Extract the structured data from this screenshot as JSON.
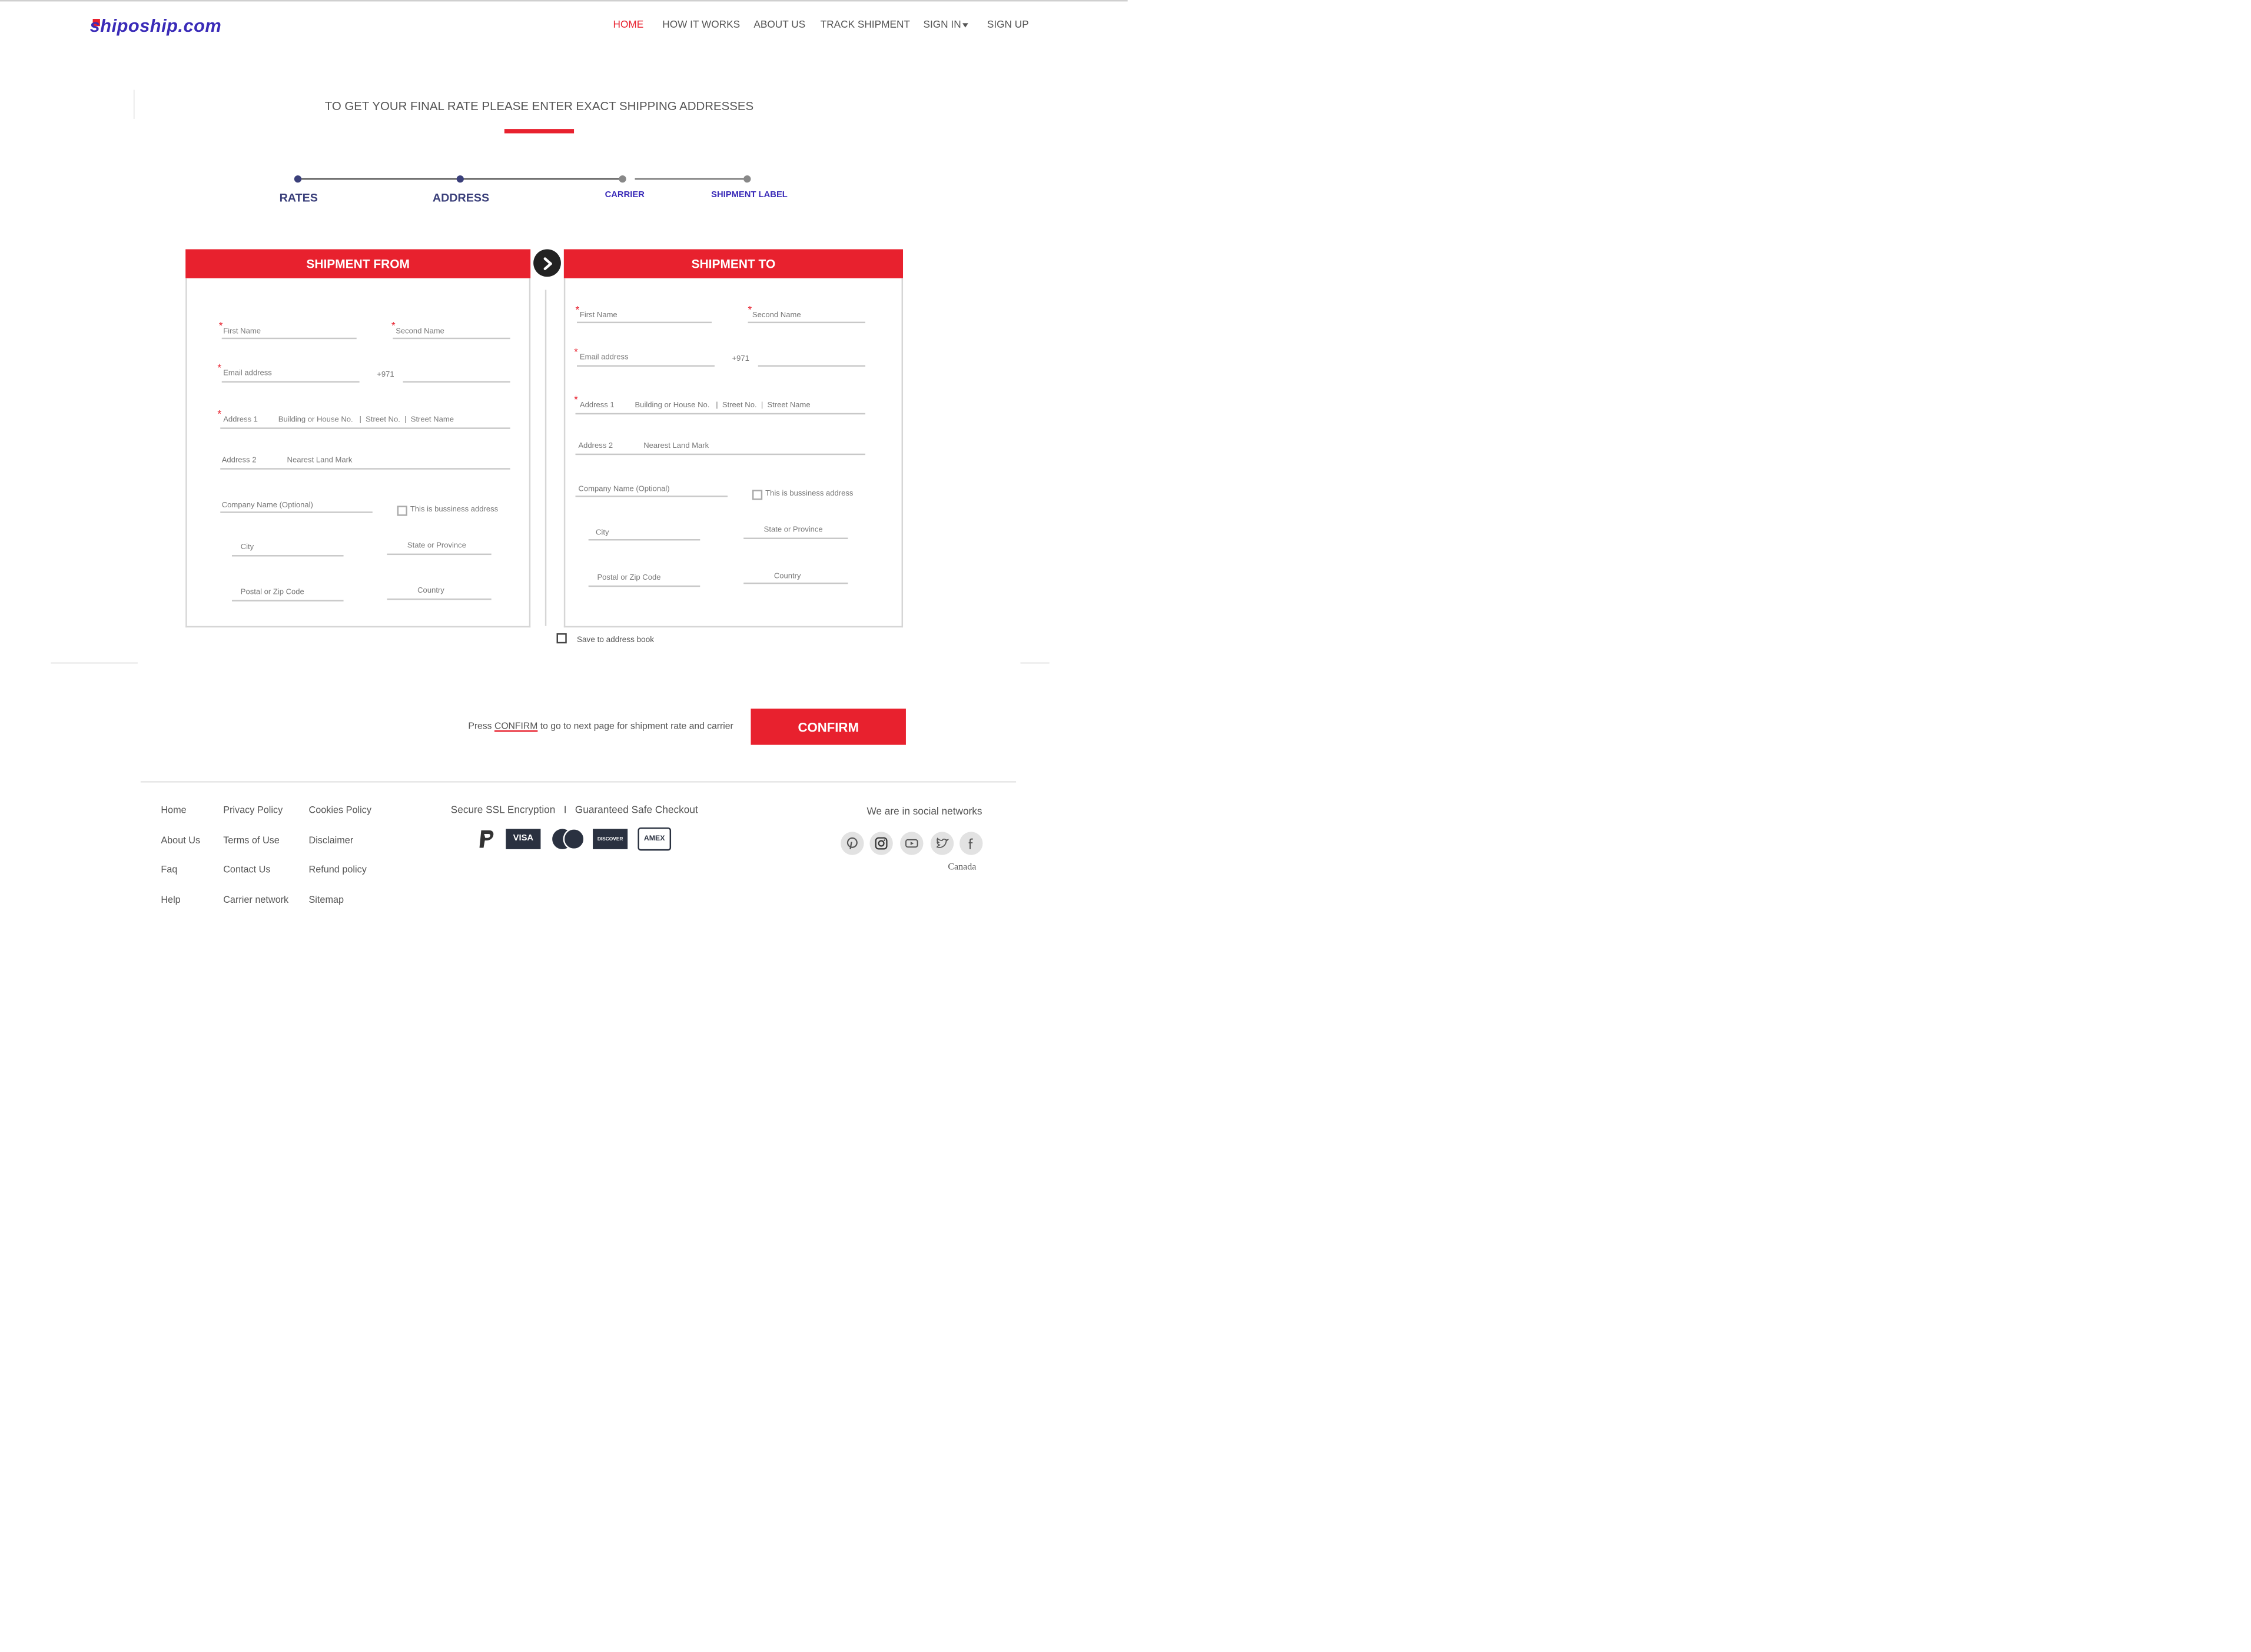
{
  "brand": {
    "name": "shipoship.com",
    "accent": "#e8212e",
    "logo_color": "#3a2bb8"
  },
  "nav": {
    "items": [
      {
        "label": "HOME",
        "active": true
      },
      {
        "label": "HOW IT WORKS",
        "active": false
      },
      {
        "label": "ABOUT US",
        "active": false
      },
      {
        "label": "TRACK SHIPMENT",
        "active": false
      },
      {
        "label": "SIGN IN",
        "active": false,
        "dropdown": true
      },
      {
        "label": "SIGN UP",
        "active": false
      }
    ]
  },
  "main": {
    "heading": "TO GET YOUR FINAL RATE PLEASE ENTER EXACT SHIPPING ADDRESSES",
    "steps": [
      {
        "label": "RATES",
        "state": "done"
      },
      {
        "label": "ADDRESS",
        "state": "current"
      },
      {
        "label": "CARRIER",
        "state": "todo"
      },
      {
        "label": "SHIPMENT LABEL",
        "state": "todo"
      }
    ],
    "step_colors": {
      "done": "#3a3f7a",
      "todo": "#3a2bb8"
    },
    "from": {
      "title": "SHIPMENT FROM",
      "first_name": "First Name",
      "second_name": "Second Name",
      "email": "Email address",
      "phone_prefix": "+971",
      "address1_label": "Address 1",
      "address1_hint": "Building or House No.   |  Street No.  |  Street Name",
      "address2_label": "Address 2",
      "address2_hint": "Nearest Land Mark",
      "company": "Company Name (Optional)",
      "business_checkbox": "This is bussiness address",
      "city": "City",
      "state": "State or Province",
      "postal": "Postal or Zip Code",
      "country": "Country"
    },
    "to": {
      "title": "SHIPMENT TO",
      "first_name": "First Name",
      "second_name": "Second Name",
      "email": "Email address",
      "phone_prefix": "+971",
      "address1_label": "Address 1",
      "address1_hint": "Building or House No.   |  Street No.  |  Street Name",
      "address2_label": "Address 2",
      "address2_hint": "Nearest Land Mark",
      "company": "Company Name (Optional)",
      "business_checkbox": "This is bussiness address",
      "city": "City",
      "state": "State or Province",
      "postal": "Postal or Zip Code",
      "country": "Country"
    },
    "save_address_book": "Save to address book",
    "confirm_prefix": "Press ",
    "confirm_word": "CONFIRM",
    "confirm_suffix": " to go to next page for shipment rate and carrier",
    "confirm_button": "CONFIRM"
  },
  "footer": {
    "col1": [
      "Home",
      "About Us",
      "Faq",
      "Help"
    ],
    "col2": [
      "Privacy Policy",
      "Terms of Use",
      "Contact Us",
      "Carrier network"
    ],
    "col3": [
      "Cookies Policy",
      "Disclaimer",
      "Refund policy",
      "Sitemap"
    ],
    "secure_text": "Secure SSL Encryption   I   Guaranteed Safe Checkout",
    "payment_methods": [
      "paypal-icon",
      "visa-icon",
      "mastercard-icon",
      "discover-icon",
      "amex-icon"
    ],
    "visa_label": "VISA",
    "discover_label": "DISCOVER",
    "amex_label": "AMEX",
    "social_label": "We are in social networks",
    "social_icons": [
      "pinterest-icon",
      "instagram-icon",
      "youtube-icon",
      "twitter-icon",
      "facebook-icon"
    ],
    "country_text": "Canada"
  }
}
